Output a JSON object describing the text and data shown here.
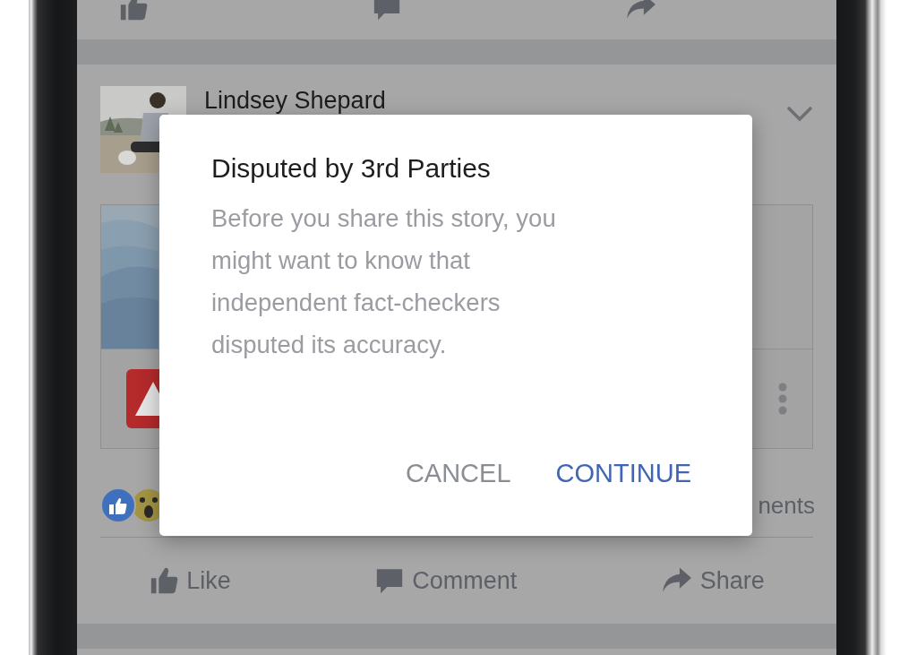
{
  "post": {
    "author": "Lindsey Shepard",
    "comments_count": "nents",
    "actions": [
      {
        "label": "Like",
        "kind": "like"
      },
      {
        "label": "Comment",
        "kind": "comment"
      },
      {
        "label": "Share",
        "kind": "share"
      }
    ]
  },
  "dialog": {
    "title": "Disputed by 3rd Parties",
    "message": "Before you share this story, you might want to know that independent fact-checkers disputed its accuracy.",
    "buttons": [
      {
        "label": "CANCEL",
        "kind": "secondary"
      },
      {
        "label": "CONTINUE",
        "kind": "primary"
      }
    ]
  }
}
